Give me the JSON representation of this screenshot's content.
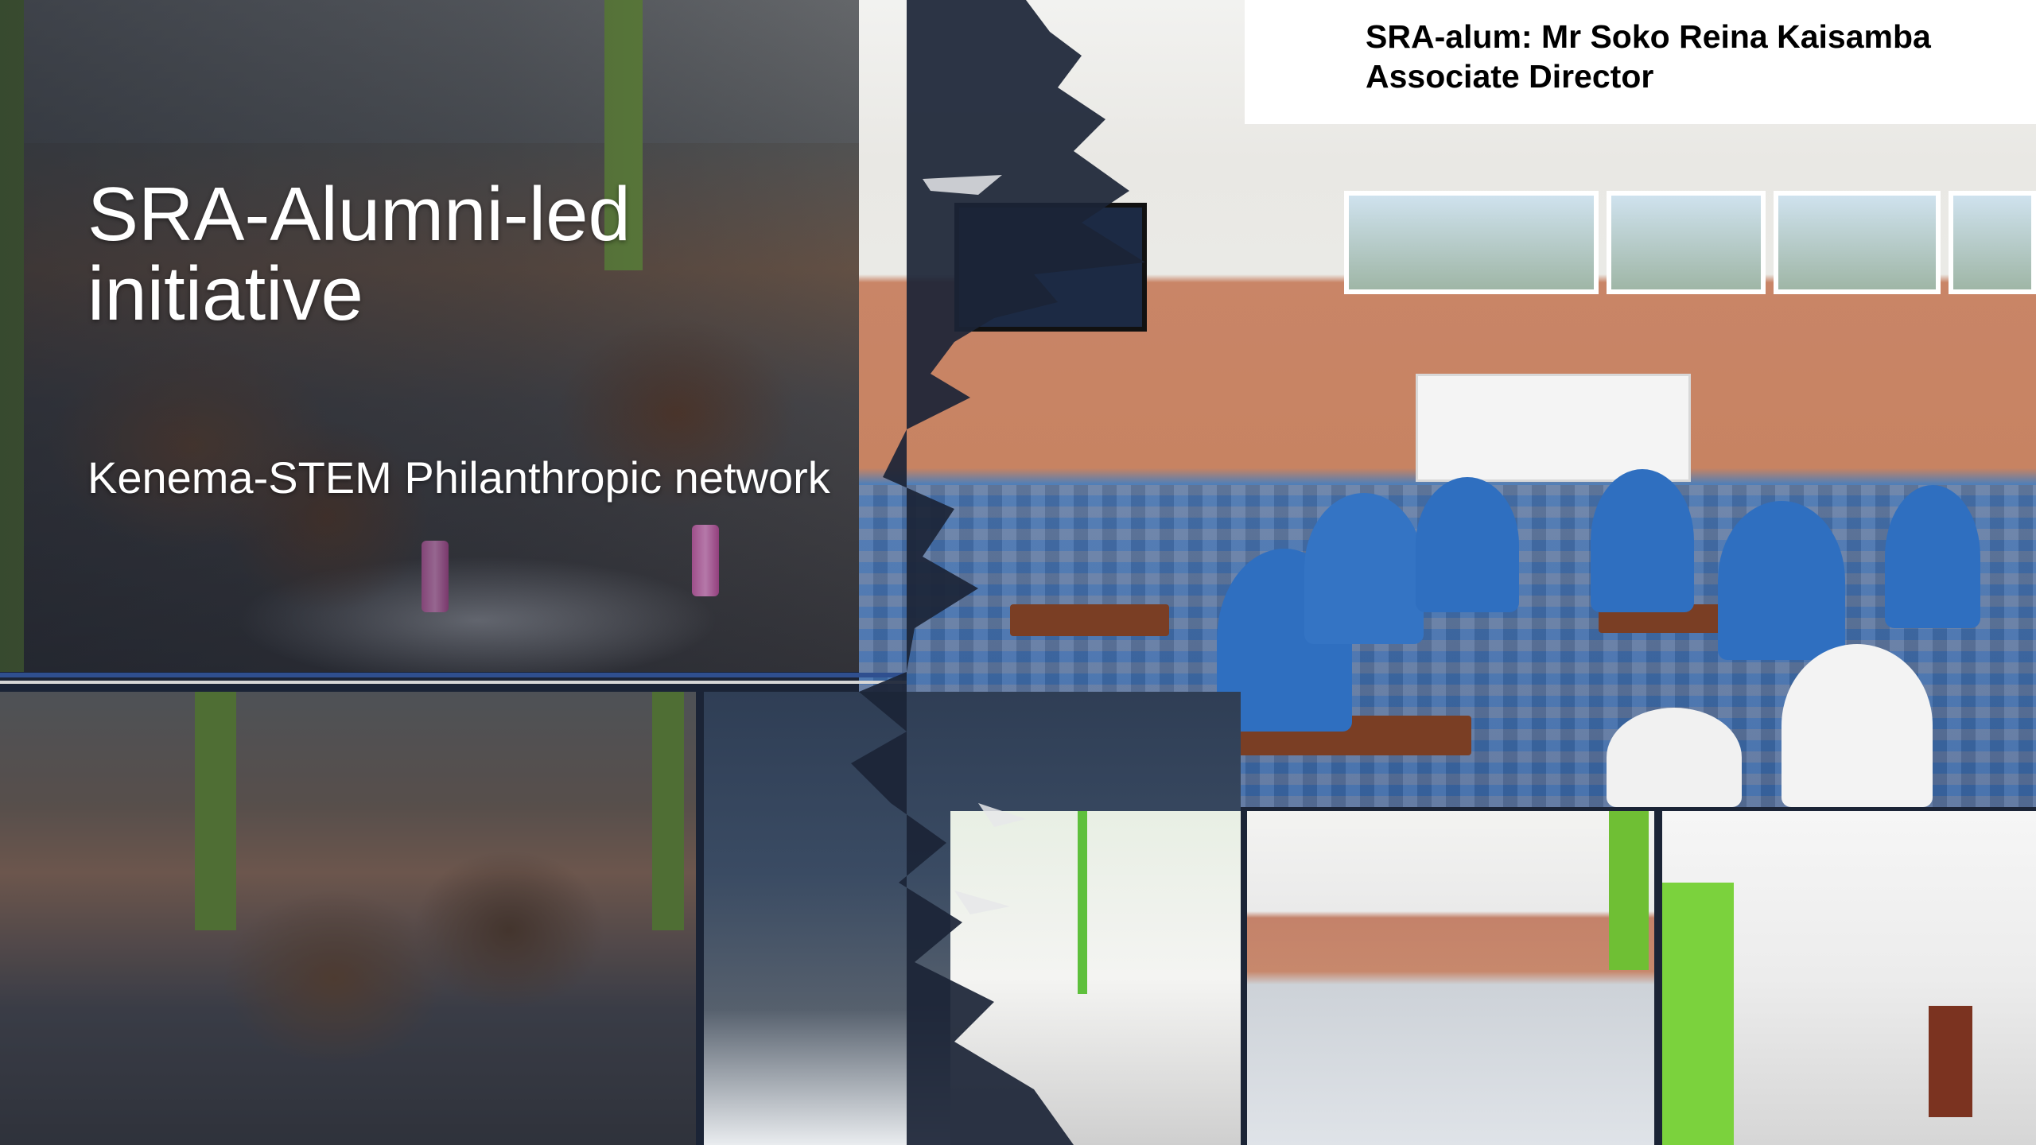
{
  "slide": {
    "title": "SRA-Alumni-led initiative",
    "subtitle": "Kenema-STEM Philanthropic network"
  },
  "credit": {
    "name": "SRA-alum: Mr Soko Reina Kaisamba",
    "role": "Associate Director"
  },
  "colors": {
    "accent_green": "#6f9540",
    "wall_orange": "#c98567",
    "uniform_blue": "#2f6fc0",
    "divider_navy": "#2f4f8f",
    "torn_edge_dark": "#1b2436"
  }
}
